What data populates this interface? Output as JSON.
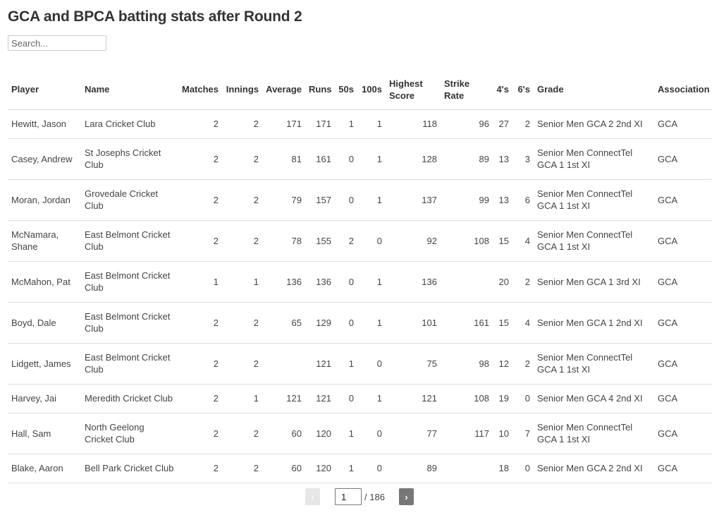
{
  "page": {
    "title": "GCA and BPCA batting stats after Round 2"
  },
  "search": {
    "placeholder": "Search...",
    "value": ""
  },
  "table": {
    "columns": [
      {
        "key": "player",
        "label": "Player",
        "numeric": false
      },
      {
        "key": "name",
        "label": "Name",
        "numeric": false
      },
      {
        "key": "matches",
        "label": "Matches",
        "numeric": true
      },
      {
        "key": "innings",
        "label": "Innings",
        "numeric": true
      },
      {
        "key": "average",
        "label": "Average",
        "numeric": true
      },
      {
        "key": "runs",
        "label": "Runs",
        "numeric": true
      },
      {
        "key": "fifties",
        "label": "50s",
        "numeric": true
      },
      {
        "key": "hundreds",
        "label": "100s",
        "numeric": true
      },
      {
        "key": "highest",
        "label": "Highest Score",
        "numeric": true,
        "header_align": "left"
      },
      {
        "key": "strike_rate",
        "label": "Strike Rate",
        "numeric": true,
        "header_align": "left"
      },
      {
        "key": "fours",
        "label": "4's",
        "numeric": true
      },
      {
        "key": "sixes",
        "label": "6's",
        "numeric": true
      },
      {
        "key": "grade",
        "label": "Grade",
        "numeric": false
      },
      {
        "key": "association",
        "label": "Association",
        "numeric": false
      }
    ],
    "rows": [
      {
        "player": "Hewitt, Jason",
        "name": "Lara Cricket Club",
        "matches": "2",
        "innings": "2",
        "average": "171",
        "runs": "171",
        "fifties": "1",
        "hundreds": "1",
        "highest": "118",
        "strike_rate": "96",
        "fours": "27",
        "sixes": "2",
        "grade": "Senior Men GCA 2 2nd XI",
        "association": "GCA",
        "tall": false
      },
      {
        "player": "Casey, Andrew",
        "name": "St Josephs Cricket Club",
        "matches": "2",
        "innings": "2",
        "average": "81",
        "runs": "161",
        "fifties": "0",
        "hundreds": "1",
        "highest": "128",
        "strike_rate": "89",
        "fours": "13",
        "sixes": "3",
        "grade": "Senior Men ConnectTel GCA 1 1st XI",
        "association": "GCA",
        "tall": true
      },
      {
        "player": "Moran, Jordan",
        "name": "Grovedale Cricket Club",
        "matches": "2",
        "innings": "2",
        "average": "79",
        "runs": "157",
        "fifties": "0",
        "hundreds": "1",
        "highest": "137",
        "strike_rate": "99",
        "fours": "13",
        "sixes": "6",
        "grade": "Senior Men ConnectTel GCA 1 1st XI",
        "association": "GCA",
        "tall": true
      },
      {
        "player": "McNamara, Shane",
        "name": "East Belmont Cricket Club",
        "matches": "2",
        "innings": "2",
        "average": "78",
        "runs": "155",
        "fifties": "2",
        "hundreds": "0",
        "highest": "92",
        "strike_rate": "108",
        "fours": "15",
        "sixes": "4",
        "grade": "Senior Men ConnectTel GCA 1 1st XI",
        "association": "GCA",
        "tall": true
      },
      {
        "player": "McMahon, Pat",
        "name": "East Belmont Cricket Club",
        "matches": "1",
        "innings": "1",
        "average": "136",
        "runs": "136",
        "fifties": "0",
        "hundreds": "1",
        "highest": "136",
        "strike_rate": "",
        "fours": "20",
        "sixes": "2",
        "grade": "Senior Men GCA 1 3rd XI",
        "association": "GCA",
        "tall": true
      },
      {
        "player": "Boyd, Dale",
        "name": "East Belmont Cricket Club",
        "matches": "2",
        "innings": "2",
        "average": "65",
        "runs": "129",
        "fifties": "0",
        "hundreds": "1",
        "highest": "101",
        "strike_rate": "161",
        "fours": "15",
        "sixes": "4",
        "grade": "Senior Men GCA 1 2nd XI",
        "association": "GCA",
        "tall": true
      },
      {
        "player": "Lidgett, James",
        "name": "East Belmont Cricket Club",
        "matches": "2",
        "innings": "2",
        "average": "",
        "runs": "121",
        "fifties": "1",
        "hundreds": "0",
        "highest": "75",
        "strike_rate": "98",
        "fours": "12",
        "sixes": "2",
        "grade": "Senior Men ConnectTel GCA 1 1st XI",
        "association": "GCA",
        "tall": true
      },
      {
        "player": "Harvey, Jai",
        "name": "Meredith Cricket Club",
        "matches": "2",
        "innings": "1",
        "average": "121",
        "runs": "121",
        "fifties": "0",
        "hundreds": "1",
        "highest": "121",
        "strike_rate": "108",
        "fours": "19",
        "sixes": "0",
        "grade": "Senior Men GCA 4 2nd XI",
        "association": "GCA",
        "tall": false
      },
      {
        "player": "Hall, Sam",
        "name": "North Geelong Cricket Club",
        "matches": "2",
        "innings": "2",
        "average": "60",
        "runs": "120",
        "fifties": "1",
        "hundreds": "0",
        "highest": "77",
        "strike_rate": "117",
        "fours": "10",
        "sixes": "7",
        "grade": "Senior Men ConnectTel GCA 1 1st XI",
        "association": "GCA",
        "tall": true
      },
      {
        "player": "Blake, Aaron",
        "name": "Bell Park Cricket Club",
        "matches": "2",
        "innings": "2",
        "average": "60",
        "runs": "120",
        "fifties": "1",
        "hundreds": "0",
        "highest": "89",
        "strike_rate": "",
        "fours": "18",
        "sixes": "0",
        "grade": "Senior Men GCA 2 2nd XI",
        "association": "GCA",
        "tall": false
      }
    ]
  },
  "pagination": {
    "prev_icon": "‹",
    "next_icon": "›",
    "current_page": "1",
    "total_label": "/ 186",
    "prev_disabled": true
  }
}
